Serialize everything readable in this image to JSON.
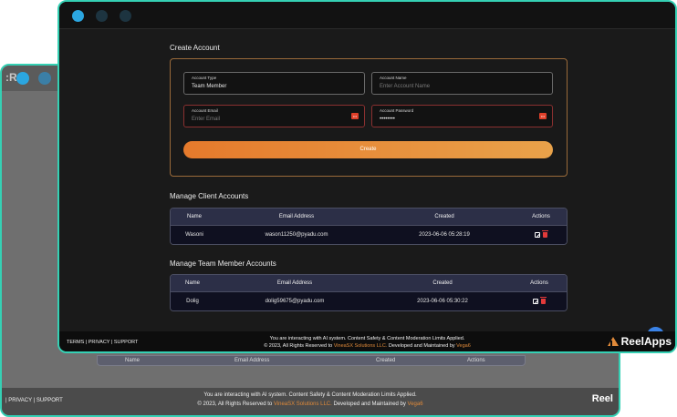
{
  "window": {
    "dots": [
      "#2ba6e0",
      "#1d3440",
      "#1d3440"
    ]
  },
  "create": {
    "title": "Create Account",
    "account_type_label": "Account Type",
    "account_type_value": "Team Member",
    "account_name_label": "Account Name",
    "account_name_placeholder": "Enter Account Name",
    "account_email_label": "Account Email",
    "account_email_placeholder": "Enter Email",
    "account_password_label": "Account Password",
    "account_password_value": "••••••••",
    "create_button": "Create"
  },
  "client_table": {
    "title": "Manage Client Accounts",
    "headers": [
      "Name",
      "Email Address",
      "Created",
      "Actions"
    ],
    "rows": [
      {
        "name": "Wasoni",
        "email": "wason11250@pyadu.com",
        "created": "2023-06-06 05:28:19"
      }
    ]
  },
  "team_table": {
    "title": "Manage Team Member Accounts",
    "headers": [
      "Name",
      "Email Address",
      "Created",
      "Actions"
    ],
    "rows": [
      {
        "name": "Dolig",
        "email": "dolig59675@pyadu.com",
        "created": "2023-06-06 05:30:22"
      }
    ]
  },
  "footer": {
    "links": "TERMS | PRIVACY | SUPPORT",
    "line1": "You are interacting with AI system. Content Safety & Content Moderation Limits Applied.",
    "line2_pre": "© 2023, All Rights Reserved to ",
    "line2_company": "VineaSX Solutions LLC.",
    "line2_mid": " Developed and Maintained by ",
    "line2_dev": "Vega6",
    "brand": "ReelApps"
  },
  "back_window": {
    "logo": ":R",
    "panel_headers": [
      "Name",
      "Email Address",
      "Created",
      "Actions"
    ],
    "links": "| PRIVACY | SUPPORT",
    "brand": "Reel"
  },
  "colors": {
    "accent": "#e57a2c",
    "border": "#35d0b4",
    "chat": "#3a82e6"
  }
}
